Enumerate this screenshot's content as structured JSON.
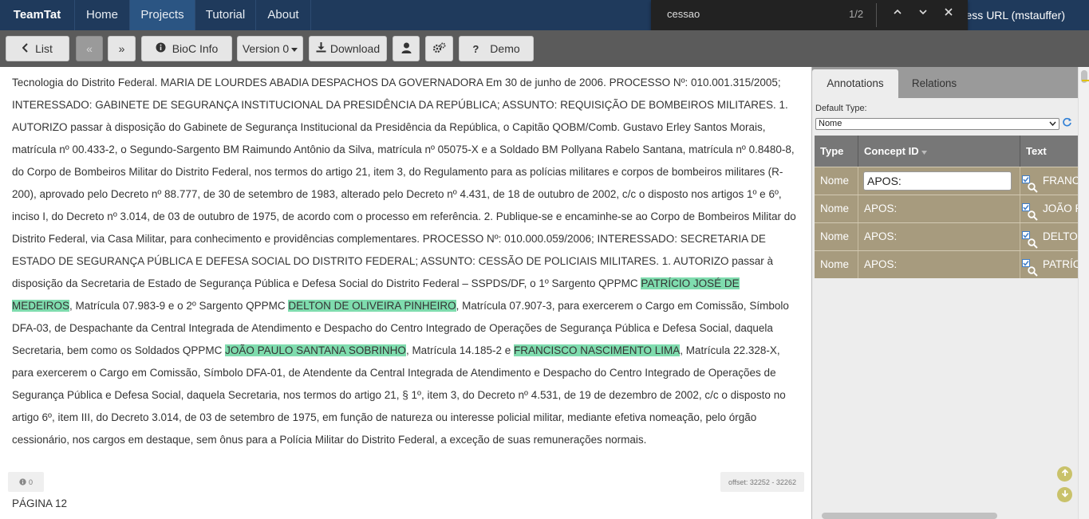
{
  "nav": {
    "brand": "TeamTat",
    "items": [
      "Home",
      "Projects",
      "Tutorial",
      "About"
    ],
    "user_url": "ccess URL (mstauffer)"
  },
  "findbar": {
    "query": "cessao",
    "count": "1/2"
  },
  "toolbar": {
    "list": "List",
    "prev": "«",
    "next": "»",
    "bioc_info": "BioC Info",
    "version": "Version 0",
    "download": "Download",
    "demo": "Demo"
  },
  "document": {
    "segments": [
      {
        "text": "Tecnologia do Distrito Federal. MARIA DE LOURDES ABADIA DESPACHOS DA GOVERNADORA Em 30 de junho de 2006. PROCESSO Nº: 010.001.315/2005; INTERESSADO: GABINETE DE SEGURANÇA INSTITUCIONAL DA PRESIDÊNCIA DA REPÚBLICA; ASSUNTO: REQUISIÇÃO DE BOMBEIROS MILITARES. 1. AUTORIZO passar à disposição do Gabinete de Segurança Institucional da Presidência da República, o Capitão QOBM/Comb. Gustavo Erley Santos Morais, matrícula nº 00.433-2, o Segundo-Sargento BM Raimundo Antônio da Silva, matrícula nº 05075-X e a Soldado BM Pollyana Rabelo Santana, matrícula nº 0.8480-8, do Corpo de Bombeiros Militar do Distrito Federal, nos termos do artigo 21, item 3, do Regulamento para as polícias militares e corpos de bombeiros militares (R-200), aprovado pelo Decreto nº 88.777, de 30 de setembro de 1983, alterado pelo Decreto nº 4.431, de 18 de outubro de 2002, c/c o disposto nos artigos 1º e 6º, inciso I, do Decreto nº 3.014, de 03 de outubro de 1975, de acordo com o processo em referência. 2. Publique-se e encaminhe-se ao Corpo de Bombeiros Militar do Distrito Federal, via Casa Militar, para conhecimento e providências complementares. PROCESSO Nº: 010.000.059/2006; INTERESSADO: SECRETARIA DE ESTADO DE SEGURANÇA PÚBLICA E DEFESA SOCIAL DO DISTRITO FEDERAL; ASSUNTO: CESSÃO DE POLICIAIS MILITARES. 1. AUTORIZO passar à disposição da Secretaria de Estado de Segurança Pública e Defesa Social do Distrito Federal – SSPDS/DF, o 1º Sargento QPPMC ",
        "highlight": false
      },
      {
        "text": "PATRÍCIO JOSÉ DE MEDEIROS",
        "highlight": true
      },
      {
        "text": ", Matrícula 07.983-9 e o 2º Sargento QPPMC ",
        "highlight": false
      },
      {
        "text": "DELTON DE OLIVEIRA PINHEIRO",
        "highlight": true
      },
      {
        "text": ", Matrícula 07.907-3, para exercerem o Cargo em Comissão, Símbolo DFA-03, de Despachante da Central Integrada de Atendimento e Despacho do Centro Integrado de Operações de Segurança Pública e Defesa Social, daquela Secretaria, bem como os Soldados QPPMC ",
        "highlight": false
      },
      {
        "text": "JOÃO PAULO SANTANA SOBRINHO",
        "highlight": true
      },
      {
        "text": ", Matrícula 14.185-2 e ",
        "highlight": false
      },
      {
        "text": "FRANCISCO NASCIMENTO LIMA",
        "highlight": true
      },
      {
        "text": ", Matrícula 22.328-X, para exercerem o Cargo em Comissão, Símbolo DFA-01, de Atendente da Central Integrada de Atendimento e Despacho do Centro Integrado de Operações de Segurança Pública e Defesa Social, daquela Secretaria, nos termos do artigo 21, § 1º, item 3, do Decreto nº 4.531, de 19 de dezembro de 2002, c/c o disposto no artigo 6º, item III, do Decreto 3.014, de 03 de setembro de 1975, em função de natureza ou interesse policial militar, mediante efetiva nomeação, pelo órgão cessionário, nos cargos em destaque, sem ônus para a Polícia Militar do Distrito Federal, a exceção de suas remunerações normais.",
        "highlight": false
      }
    ],
    "info_count": "0",
    "offset": "offset: 32252 - 32262",
    "page_label": "PÁGINA 12"
  },
  "panel": {
    "tabs": [
      "Annotations",
      "Relations"
    ],
    "default_type_label": "Default Type:",
    "default_type_value": "Nome",
    "columns": [
      "Type",
      "Concept ID",
      "Text"
    ],
    "rows": [
      {
        "type": "Nome",
        "concept": "APOS:",
        "text": "FRANCI",
        "editing": true
      },
      {
        "type": "Nome",
        "concept": "APOS:",
        "text": "JOÃO P",
        "editing": false
      },
      {
        "type": "Nome",
        "concept": "APOS:",
        "text": "DELTON",
        "editing": false
      },
      {
        "type": "Nome",
        "concept": "APOS:",
        "text": "PATRÍC",
        "editing": false
      }
    ]
  }
}
